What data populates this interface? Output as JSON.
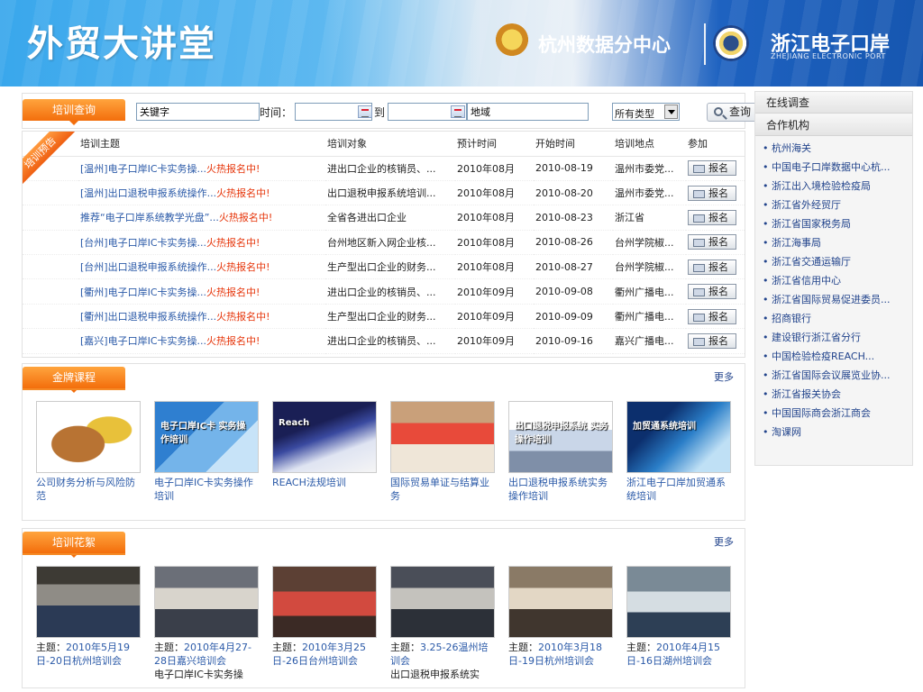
{
  "header": {
    "site_title": "外贸大讲堂",
    "logo_hangzhou": "杭州数据分中心",
    "logo_zhejiang": "浙江电子口岸",
    "logo_zhejiang_en": "ZHEJIANG ELECTRONIC PORT"
  },
  "search": {
    "tab_label": "培训查询",
    "keyword_placeholder": "关键字",
    "time_label": "时间：",
    "to_label": "到",
    "location_placeholder": "地域",
    "type_selected": "所有类型",
    "query_label": "查询"
  },
  "training": {
    "ribbon_label": "培训预告",
    "columns": [
      "培训主题",
      "培训对象",
      "预计时间",
      "开始时间",
      "培训地点",
      "参加"
    ],
    "register_label": "报名",
    "rows": [
      {
        "topic": "[温州]电子口岸IC卡实务操...",
        "hot": "火热报名中!",
        "target": "进出口企业的核销员、...",
        "planned": "2010年08月",
        "start": "2010-08-19",
        "place": "温州市委党..."
      },
      {
        "topic": "[温州]出口退税申报系统操作...",
        "hot": "火热报名中!",
        "target": "出口退税申报系统培训...",
        "planned": "2010年08月",
        "start": "2010-08-20",
        "place": "温州市委党..."
      },
      {
        "topic": "推荐“电子口岸系统教学光盘”...",
        "hot": "火热报名中!",
        "target": "全省各进出口企业",
        "planned": "2010年08月",
        "start": "2010-08-23",
        "place": "浙江省"
      },
      {
        "topic": "[台州]电子口岸IC卡实务操...",
        "hot": "火热报名中!",
        "target": "台州地区新入网企业核...",
        "planned": "2010年08月",
        "start": "2010-08-26",
        "place": "台州学院椒..."
      },
      {
        "topic": "[台州]出口退税申报系统操作...",
        "hot": "火热报名中!",
        "target": "生产型出口企业的财务...",
        "planned": "2010年08月",
        "start": "2010-08-27",
        "place": "台州学院椒..."
      },
      {
        "topic": "[衢州]电子口岸IC卡实务操...",
        "hot": "火热报名中!",
        "target": "进出口企业的核销员、...",
        "planned": "2010年09月",
        "start": "2010-09-08",
        "place": "衢州广播电..."
      },
      {
        "topic": "[衢州]出口退税申报系统操作...",
        "hot": "火热报名中!",
        "target": "生产型出口企业的财务...",
        "planned": "2010年09月",
        "start": "2010-09-09",
        "place": "衢州广播电..."
      },
      {
        "topic": "[嘉兴]电子口岸IC卡实务操...",
        "hot": "火热报名中!",
        "target": "进出口企业的核销员、...",
        "planned": "2010年09月",
        "start": "2010-09-16",
        "place": "嘉兴广播电..."
      }
    ]
  },
  "courses": {
    "tab_label": "金牌课程",
    "more_label": "更多",
    "items": [
      {
        "title": "公司财务分析与风险防范",
        "img_text": ""
      },
      {
        "title": "电子口岸IC卡实务操作培训",
        "img_text": "电子口岸IC卡 实务操作培训"
      },
      {
        "title": "REACH法规培训",
        "img_text": "Reach"
      },
      {
        "title": "国际贸易单证与结算业务",
        "img_text": ""
      },
      {
        "title": "出口退税申报系统实务操作培训",
        "img_text": "出口退税申报系统 实务操作培训"
      },
      {
        "title": "浙江电子口岸加贸通系统培训",
        "img_text": "加贸通系统培训"
      }
    ]
  },
  "gallery": {
    "tab_label": "培训花絮",
    "more_label": "更多",
    "topic_label": "主题：",
    "items": [
      {
        "caption": "2010年5月19日-20日杭州培训会"
      },
      {
        "caption": "2010年4月27-28日嘉兴培训会",
        "extra": "电子口岸IC卡实务操"
      },
      {
        "caption": "2010年3月25日-26日台州培训会"
      },
      {
        "caption": "3.25-26温州培训会",
        "extra": "出口退税申报系统实"
      },
      {
        "caption": "2010年3月18日-19日杭州培训会"
      },
      {
        "caption": "2010年4月15日-16日湖州培训会"
      }
    ]
  },
  "sidebar": {
    "survey_label": "在线调查",
    "partners_label": "合作机构",
    "partners": [
      "杭州海关",
      "中国电子口岸数据中心杭...",
      "浙江出入境检验检疫局",
      "浙江省外经贸厅",
      "浙江省国家税务局",
      "浙江海事局",
      "浙江省交通运输厅",
      "浙江省信用中心",
      "浙江省国际贸易促进委员...",
      "招商银行",
      "建设银行浙江省分行",
      "中国检验检疫REACH...",
      "浙江省国际会议展览业协...",
      "浙江省报关协会",
      "中国国际商会浙江商会",
      "淘课网"
    ]
  }
}
